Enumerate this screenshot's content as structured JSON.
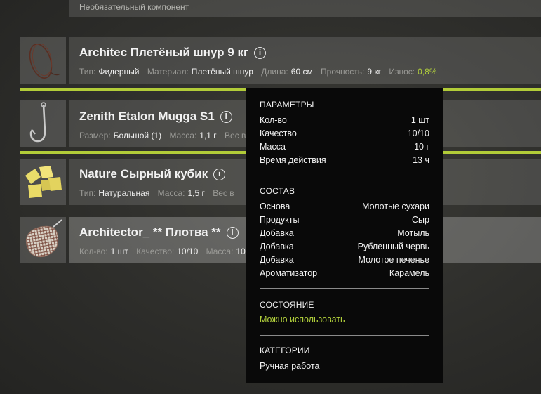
{
  "top_row": {
    "optional_text": "Необязательный компонент"
  },
  "items": [
    {
      "title": "Architec Плетёный шнур 9 кг",
      "props": [
        {
          "k": "Тип:",
          "v": "Фидерный"
        },
        {
          "k": "Материал:",
          "v": "Плетёный шнур"
        },
        {
          "k": "Длина:",
          "v": "60 см"
        },
        {
          "k": "Прочность:",
          "v": "9 кг"
        },
        {
          "k": "Износ:",
          "v": "0,8%"
        }
      ]
    },
    {
      "title": "Zenith Etalon Mugga S1",
      "props": [
        {
          "k": "Размер:",
          "v": "Большой (1)"
        },
        {
          "k": "Масса:",
          "v": "1,1 г"
        },
        {
          "k": "Вес в",
          "v": ""
        }
      ]
    },
    {
      "title": "Nature Сырный кубик",
      "props": [
        {
          "k": "Тип:",
          "v": "Натуральная"
        },
        {
          "k": "Масса:",
          "v": "1,5 г"
        },
        {
          "k": "Вес в",
          "v": ""
        }
      ]
    },
    {
      "title": "Architector_ ** Плотва **",
      "props": [
        {
          "k": "Кол-во:",
          "v": "1 шт"
        },
        {
          "k": "Качество:",
          "v": "10/10"
        },
        {
          "k": "Масса:",
          "v": "10"
        }
      ]
    }
  ],
  "info_glyph": "i",
  "tooltip": {
    "params_header": "ПАРАМЕТРЫ",
    "params": [
      {
        "k": "Кол-во",
        "v": "1 шт"
      },
      {
        "k": "Качество",
        "v": "10/10"
      },
      {
        "k": "Масса",
        "v": "10 г"
      },
      {
        "k": "Время действия",
        "v": "13 ч"
      }
    ],
    "composition_header": "СОСТАВ",
    "composition": [
      {
        "k": "Основа",
        "v": "Молотые сухари"
      },
      {
        "k": "Продукты",
        "v": "Сыр"
      },
      {
        "k": "Добавка",
        "v": "Мотыль"
      },
      {
        "k": "Добавка",
        "v": "Рубленный червь"
      },
      {
        "k": "Добавка",
        "v": "Молотое печенье"
      },
      {
        "k": "Ароматизатор",
        "v": "Карамель"
      }
    ],
    "state_header": "СОСТОЯНИЕ",
    "state_value": "Можно использовать",
    "categories_header": "КАТЕГОРИИ",
    "categories_value": "Ручная работа"
  },
  "colors": {
    "accent_green": "#b2cc38",
    "wear_green": "#b3d23c",
    "tooltip_bg": "#090909"
  }
}
